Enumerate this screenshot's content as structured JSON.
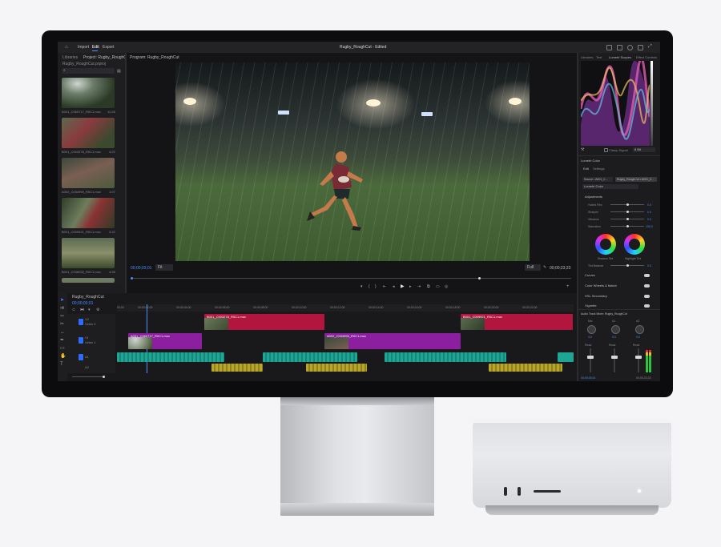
{
  "menu": {
    "import": "Import",
    "edit": "Edit",
    "export": "Export"
  },
  "window_title": "Rugby_RoughCut - Edited",
  "project_panel": {
    "tab_libraries": "Libraries",
    "tab_project": "Project: Rugby_RoughCut",
    "project_file": "Rugby_RoughCut.prproj",
    "clips": [
      {
        "name": "A001_C060717_R0C1.mov",
        "duration": "11:28"
      },
      {
        "name": "B001_C003278_R0C1.mov",
        "duration": "4:22"
      },
      {
        "name": "A002_C034990_R0C1.mov",
        "duration": "1:07"
      },
      {
        "name": "B001_C009921_R0C1.mov",
        "duration": "3:22"
      },
      {
        "name": "B001_C036032_R0C1.mov",
        "duration": "4:28"
      }
    ]
  },
  "program_monitor": {
    "tab": "Program: Rugby_RoughCut",
    "timecode_in": "00;00;03;01",
    "fit": "Fit",
    "quality": "Full",
    "duration": "00;00;23;23"
  },
  "timeline": {
    "tab": "Rugby_RoughCut",
    "timecode": "00;00;03;01",
    "ruler": [
      "00;00",
      "00;00;02;00",
      "00;00;04;00",
      "00;00;06;00",
      "00;00;08;00",
      "00;00;10;00",
      "00;00;12;00",
      "00;00;14;00",
      "00;00;16;00",
      "00;00;18;00",
      "00;00;20;00",
      "00;00;22;00"
    ],
    "tracks": [
      {
        "id": "V2",
        "name": "Video 2"
      },
      {
        "id": "V1",
        "name": "Video 1"
      },
      {
        "id": "A1",
        "name": ""
      },
      {
        "id": "A2",
        "name": ""
      }
    ],
    "clip_labels": [
      "A001_C060717_R0C1.mov",
      "B001_C003278_R0C1.mov",
      "A002_C034990_R0C1.mov",
      "B001_C009921_R0C1.mov",
      "B001_C036032_R0C1.mov"
    ]
  },
  "scopes": {
    "tabs": [
      "Libraries",
      "Text",
      "Lumetri Scopes",
      "Effect Controls"
    ],
    "clamp_label": "Clamp Signal",
    "bits": "8 Bit"
  },
  "lumetri": {
    "title": "Lumetri Color",
    "tab_edit": "Edit",
    "tab_settings": "Settings",
    "source": "Source • A001_C...",
    "target": "Rugby_RoughCut • A001_C...",
    "preset": "Lumetri Color",
    "adjustments": "Adjustments",
    "sliders": [
      {
        "label": "Faded Film",
        "value": "0.0"
      },
      {
        "label": "Sharpen",
        "value": "0.0"
      },
      {
        "label": "Vibrance",
        "value": "0.0"
      },
      {
        "label": "Saturation",
        "value": "100.0"
      }
    ],
    "wheel_left": "Shadow Tint",
    "wheel_right": "Highlight Tint",
    "tint_balance": "Tint Balance",
    "tint_value": "0.0",
    "sections": [
      "Curves",
      "Color Wheels & Match",
      "HSL Secondary",
      "Vignette"
    ]
  },
  "mixer": {
    "title": "Audio Track Mixer: Rugby_RoughCut",
    "channels": [
      "Mix",
      "A1",
      "A2"
    ],
    "knob_values": [
      "0.0",
      "0.0",
      "0.0"
    ],
    "channel_names": [
      "Read",
      "Read",
      "Read"
    ],
    "timecode": "00;00;03;01",
    "duration": "00;00;23;23"
  },
  "colors": {
    "accent": "#2d6cff",
    "video_clip": "#b2163f",
    "video_clip_2": "#8c1fa0",
    "audio_clip": "#1ea593",
    "audio_clip_2": "#b7a62a"
  }
}
